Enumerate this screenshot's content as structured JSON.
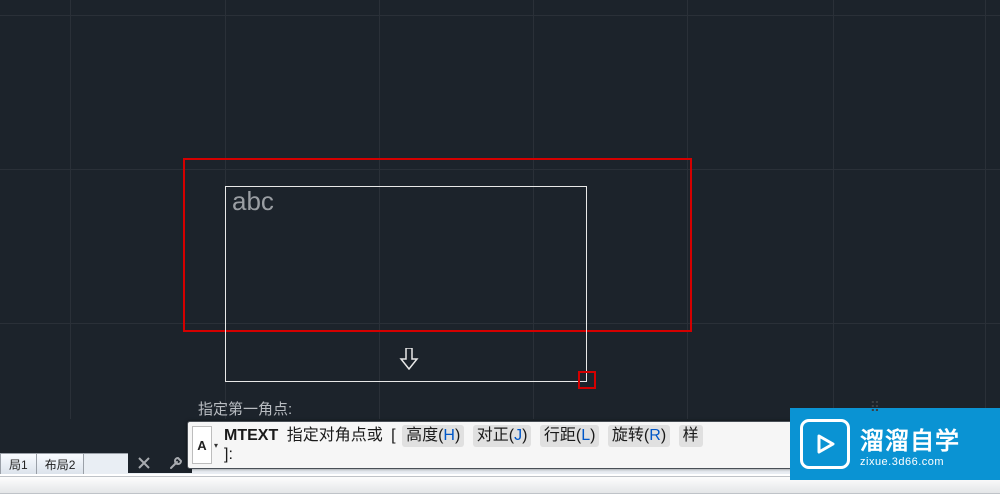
{
  "canvas": {
    "sample_text": "abc",
    "hint_text": "指定第一角点:"
  },
  "command_line": {
    "icon_letter": "A",
    "command": "MTEXT",
    "prompt": "指定对角点或",
    "bracket_open": "[",
    "options": [
      {
        "label": "高度",
        "key": "H"
      },
      {
        "label": "对正",
        "key": "J"
      },
      {
        "label": "行距",
        "key": "L"
      },
      {
        "label": "旋转",
        "key": "R"
      },
      {
        "label": "样",
        "key": ""
      }
    ],
    "line2": "]:"
  },
  "tabs": {
    "partial": "局1",
    "layout2": "布局2"
  },
  "watermark": {
    "title": "溜溜自学",
    "url": "zixue.3d66.com"
  },
  "arrows": {
    "up": "▴",
    "down": "▾"
  }
}
